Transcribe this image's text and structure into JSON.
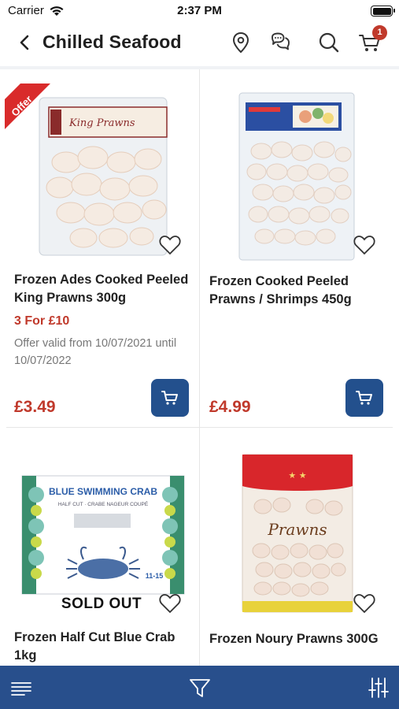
{
  "status_bar": {
    "carrier": "Carrier",
    "time": "2:37 PM"
  },
  "header": {
    "title": "Chilled Seafood",
    "cart_count": "1"
  },
  "products": [
    {
      "name": "Frozen Ades Cooked Peeled King Prawns 300g",
      "promo": "3 For £10",
      "validity": "Offer valid from 10/07/2021 until 10/07/2022",
      "price": "£3.49",
      "ribbon": "Offer",
      "package_label": "King Prawns"
    },
    {
      "name": "Frozen Cooked Peeled Prawns / Shrimps 450g",
      "price": "£4.99"
    },
    {
      "name": "Frozen Half Cut Blue Crab 1kg",
      "overlay": "SOLD OUT",
      "package_brand": "BLUE SWIMMING CRAB",
      "package_sub": "HALF CUT · CRABE NAGEUR COUPÉ",
      "package_size": "11-15"
    },
    {
      "name": "Frozen Noury Prawns 300G",
      "package_label": "Prawns"
    }
  ],
  "colors": {
    "accent_blue": "#23508d",
    "bottom_bar": "#284f8c",
    "price_red": "#c0392b",
    "badge_red": "#c0392b"
  },
  "icons": {
    "header": [
      "back-icon",
      "location-pin-icon",
      "chat-icon",
      "search-icon",
      "cart-icon"
    ],
    "bottom": [
      "menu-icon",
      "filter-icon",
      "sliders-icon"
    ]
  }
}
